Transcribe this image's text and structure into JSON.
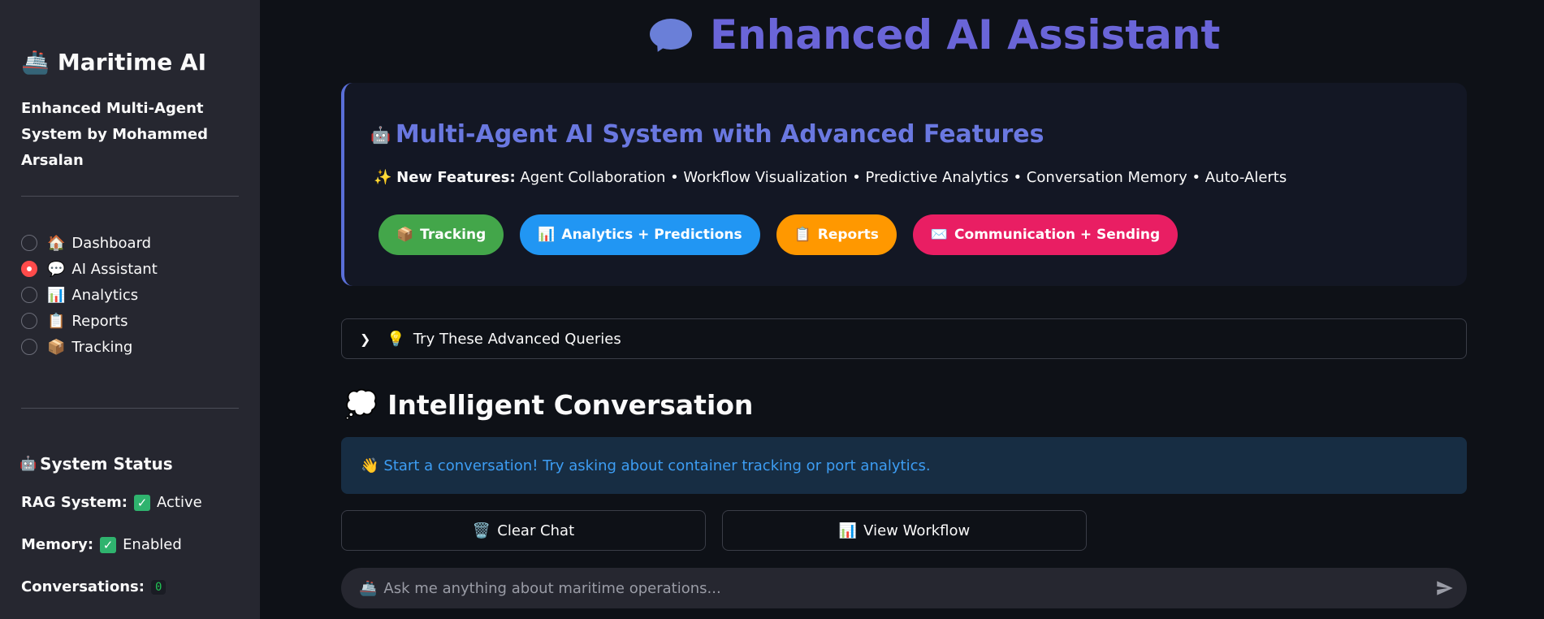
{
  "sidebar": {
    "brand_icon": "🚢",
    "brand_title": "Maritime AI",
    "subtitle": "Enhanced Multi-Agent System by Mohammed Arsalan",
    "nav": [
      {
        "emoji": "🏠",
        "label": "Dashboard",
        "selected": false
      },
      {
        "emoji": "💬",
        "label": "AI Assistant",
        "selected": true
      },
      {
        "emoji": "📊",
        "label": "Analytics",
        "selected": false
      },
      {
        "emoji": "📋",
        "label": "Reports",
        "selected": false
      },
      {
        "emoji": "📦",
        "label": "Tracking",
        "selected": false
      }
    ],
    "status": {
      "icon": "🤖",
      "title": "System Status",
      "rag_label": "RAG System:",
      "rag_value": "Active",
      "memory_label": "Memory:",
      "memory_value": "Enabled",
      "conversations_label": "Conversations:",
      "conversations_value": "0"
    }
  },
  "main": {
    "title": "Enhanced AI Assistant",
    "feature_card": {
      "icon": "🤖",
      "heading": "Multi-Agent AI System with Advanced Features",
      "sparkle": "✨",
      "new_label": "New Features:",
      "new_text": "Agent Collaboration • Workflow Visualization • Predictive Analytics • Conversation Memory • Auto-Alerts",
      "pills": [
        {
          "emoji": "📦",
          "label": "Tracking",
          "color": "#43a64a"
        },
        {
          "emoji": "📊",
          "label": "Analytics + Predictions",
          "color": "#2196f3"
        },
        {
          "emoji": "📋",
          "label": "Reports",
          "color": "#ff9800"
        },
        {
          "emoji": "✉️",
          "label": "Communication + Sending",
          "color": "#e91e63"
        }
      ]
    },
    "expander": {
      "emoji": "💡",
      "label": "Try These Advanced Queries"
    },
    "section": {
      "emoji": "💭",
      "title": "Intelligent Conversation"
    },
    "info": {
      "emoji": "👋",
      "text": "Start a conversation! Try asking about container tracking or port analytics."
    },
    "buttons": {
      "clear_emoji": "🗑️",
      "clear_label": "Clear Chat",
      "workflow_emoji": "📊",
      "workflow_label": "View Workflow"
    },
    "chat": {
      "prefix": "🚢",
      "placeholder": "Ask me anything about maritime operations..."
    }
  }
}
